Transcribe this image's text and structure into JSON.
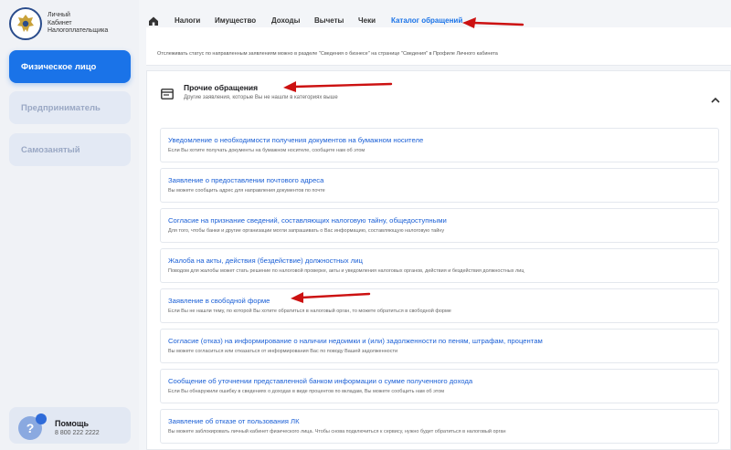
{
  "logo": {
    "line1": "Личный",
    "line2": "Кабинет",
    "line3": "Налогоплательщика",
    "icon": "fns-emblem-icon"
  },
  "roles": [
    {
      "label": "Физическое лицо",
      "active": true
    },
    {
      "label": "Предприниматель",
      "active": false
    },
    {
      "label": "Самозанятый",
      "active": false
    }
  ],
  "help": {
    "title": "Помощь",
    "phone": "8 800 222 2222",
    "icon": "question-icon"
  },
  "nav": {
    "home_icon": "home-icon",
    "tabs": [
      "Налоги",
      "Имущество",
      "Доходы",
      "Вычеты",
      "Чеки",
      "Каталог обращений"
    ],
    "active_tab": "Каталог обращений"
  },
  "previous_card": {
    "status_text": "Отслеживать статус по направленным заявлениям можно в разделе \"Сведения о бизнесе\" на странице \"Сведения\" в Профиле Личного кабинета"
  },
  "section": {
    "title": "Прочие обращения",
    "subtitle": "Другие заявления, которые Вы не нашли в категориях выше",
    "items": [
      {
        "title": "Уведомление о необходимости получения документов на бумажном носителе",
        "desc": "Если Вы хотите получать документы на бумажном носителе, сообщите нам об этом"
      },
      {
        "title": "Заявление о предоставлении почтового адреса",
        "desc": "Вы можете сообщить адрес для направления документов по почте"
      },
      {
        "title": "Согласие на признание сведений, составляющих налоговую тайну, общедоступными",
        "desc": "Для того, чтобы банки и другие организации могли запрашивать о Вас информацию, составляющую налоговую тайну"
      },
      {
        "title": "Жалоба на акты, действия (бездействие) должностных лиц",
        "desc": "Поводом для жалобы может стать решение по налоговой проверке, акты и уведомления налоговых органов, действия и бездействия должностных лиц"
      },
      {
        "title": "Заявление в свободной форме",
        "desc": "Если Вы не нашли тему, по которой Вы хотите обратиться в налоговый орган, то можете обратиться в свободной форме"
      },
      {
        "title": "Согласие (отказ) на информирование о наличии недоимки и (или) задолженности по пеням, штрафам, процентам",
        "desc": "Вы можете согласиться или отказаться от информирования Вас по поводу Вашей задолженности"
      },
      {
        "title": "Сообщение об уточнении представленной банком информации о сумме полученного дохода",
        "desc": "Если Вы обнаружили ошибку в сведениях о доходах в виде процентов по вкладам, Вы можете сообщить нам об этом"
      },
      {
        "title": "Заявление об отказе от пользования ЛК",
        "desc": "Вы можете заблокировать личный кабинет физического лица. Чтобы снова подключиться к сервису, нужно будет обратиться в налоговый орган"
      }
    ]
  },
  "colors": {
    "accent": "#1a73e8",
    "link": "#1a5fd6",
    "annotation_arrow": "#cc1111"
  }
}
